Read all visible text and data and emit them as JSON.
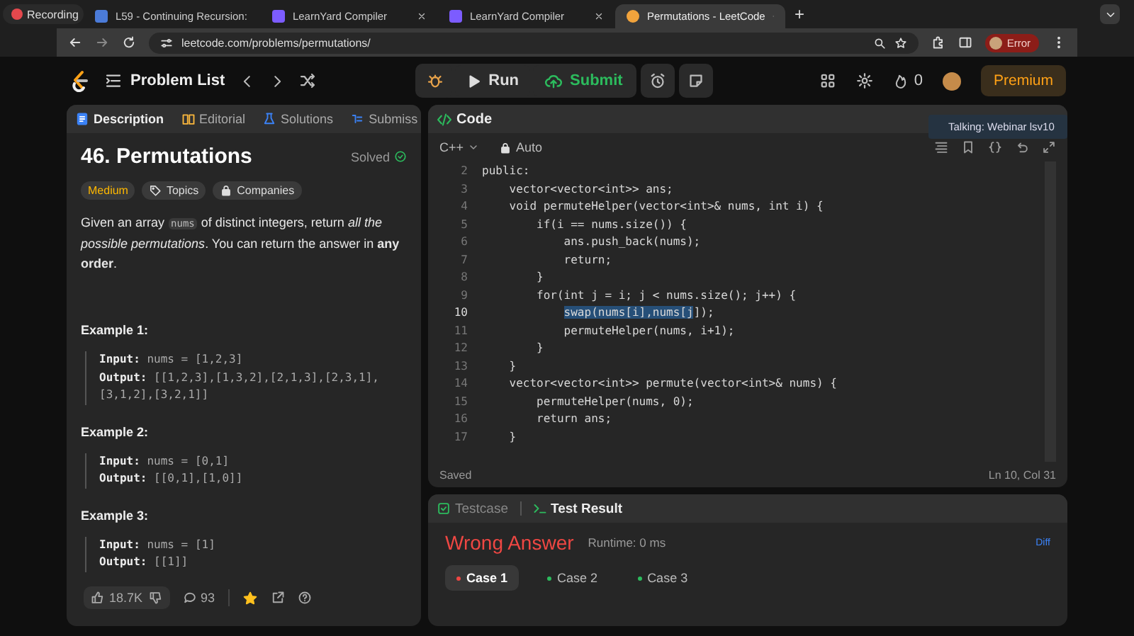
{
  "browser": {
    "recording": "Recording",
    "tabs": [
      {
        "title": "L59 - Continuing Recursion:",
        "selected": false
      },
      {
        "title": "LearnYard Compiler",
        "selected": false
      },
      {
        "title": "LearnYard Compiler",
        "selected": false
      },
      {
        "title": "Permutations - LeetCode",
        "selected": true
      }
    ],
    "new_tab": "+",
    "url": "leetcode.com/problems/permutations/",
    "profile": "Error"
  },
  "header": {
    "problem_list": "Problem List",
    "run": "Run",
    "submit": "Submit",
    "streak": "0",
    "premium": "Premium"
  },
  "description": {
    "tabs": [
      {
        "label": "Description",
        "selected": true
      },
      {
        "label": "Editorial",
        "selected": false
      },
      {
        "label": "Solutions",
        "selected": false
      },
      {
        "label": "Submiss",
        "selected": false
      }
    ],
    "title": "46. Permutations",
    "status": "Solved",
    "difficulty": "Medium",
    "topics": "Topics",
    "companies": "Companies",
    "text_before": "Given an array ",
    "text_code": "nums",
    "text_after": " of distinct integers, return *all the possible permutations*. You can return the answer in **any order**.",
    "examples": [
      {
        "title": "Example 1:",
        "lines": [
          "**Input:** nums = [1,2,3]",
          "**Output:** [[1,2,3],[1,3,2],[2,1,3],[2,3,1],[3,1,2],[3,2,1]]"
        ]
      },
      {
        "title": "Example 2:",
        "lines": [
          "**Input:** nums = [0,1]",
          "**Output:** [[0,1],[1,0]]"
        ]
      },
      {
        "title": "Example 3:",
        "lines": [
          "**Input:** nums = [1]",
          "**Output:** [[1]]"
        ]
      }
    ],
    "likes": "18.7K",
    "comments": "93",
    "favorited": true
  },
  "code": {
    "title": "Code",
    "language": "C++",
    "mode": "Auto",
    "lines": [
      {
        "number": "2",
        "text": "public:"
      },
      {
        "number": "3",
        "text": "    vector<vector<int>> ans;"
      },
      {
        "number": "4",
        "text": "    void permuteHelper(vector<int>& nums, int i) {"
      },
      {
        "number": "5",
        "text": "        if(i == nums.size()) {"
      },
      {
        "number": "6",
        "text": "            ans.push_back(nums);"
      },
      {
        "number": "7",
        "text": "            return;"
      },
      {
        "number": "8",
        "text": "        }"
      },
      {
        "number": "9",
        "text": "        for(int j = i; j < nums.size(); j++) {"
      },
      {
        "number": "10",
        "selection": "swap(nums[i],nums[j",
        "rest": "]);",
        "current": true
      },
      {
        "number": "11",
        "text": "            permuteHelper(nums, i+1);"
      },
      {
        "number": "12",
        "text": "        }"
      },
      {
        "number": "13",
        "text": "    }"
      },
      {
        "number": "14",
        "text": "    vector<vector<int>> permute(vector<int>& nums) {"
      },
      {
        "number": "15",
        "text": "        permuteHelper(nums, 0);"
      },
      {
        "number": "16",
        "text": "        return ans;"
      },
      {
        "number": "17",
        "text": "    }"
      }
    ],
    "saved": "Saved",
    "position": "Ln 10, Col 31"
  },
  "result": {
    "tabs": [
      {
        "label": "Testcase",
        "selected": false
      },
      {
        "label": "Test Result",
        "selected": true
      }
    ],
    "verdict": "Wrong Answer",
    "runtime": "Runtime: 0 ms",
    "diff": "Diff",
    "cases": [
      {
        "label": "Case 1",
        "selected": true,
        "color": "#ef4743"
      },
      {
        "label": "Case 2",
        "selected": false,
        "color": "#2cbb5d"
      },
      {
        "label": "Case 3",
        "selected": false,
        "color": "#2cbb5d"
      }
    ]
  },
  "tooltip": "Talking: Webinar lsv10"
}
